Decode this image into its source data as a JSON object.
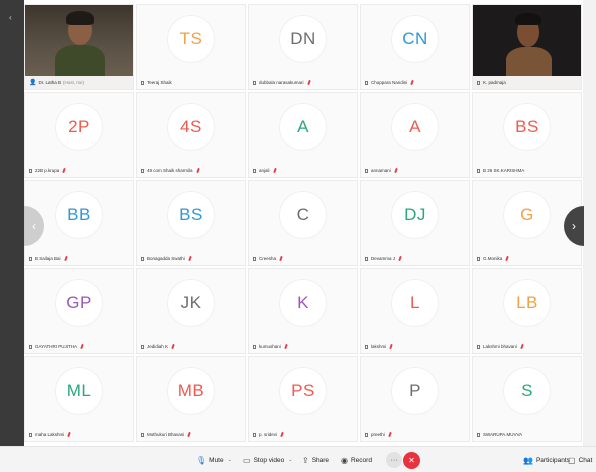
{
  "participants": [
    {
      "initials": "",
      "name": "Dr. Latha B",
      "tag": "(Host, me)",
      "video": true,
      "color": ""
    },
    {
      "initials": "TS",
      "name": "Teeraj Shaik",
      "video": false,
      "color": "#f0a245"
    },
    {
      "initials": "DN",
      "name": "dubbala narasakumari",
      "video": false,
      "color": "#6e6e6e"
    },
    {
      "initials": "CN",
      "name": "Choppara Nandini",
      "video": false,
      "color": "#2f97d6"
    },
    {
      "initials": "",
      "name": "K. padmaja",
      "video": true,
      "color": ""
    },
    {
      "initials": "2P",
      "name": "22B p.krupa",
      "video": false,
      "color": "#ef5a4d"
    },
    {
      "initials": "4S",
      "name": "49 com Shaik sharmila",
      "video": false,
      "color": "#ef5a4d"
    },
    {
      "initials": "A",
      "name": "anjali",
      "video": false,
      "color": "#2aa77a"
    },
    {
      "initials": "A",
      "name": "annamani",
      "video": false,
      "color": "#ef5a4d"
    },
    {
      "initials": "BS",
      "name": "B 26 SK.KARISHMA",
      "video": false,
      "color": "#ef5a4d"
    },
    {
      "initials": "BB",
      "name": "B Sailaja Bai",
      "video": false,
      "color": "#2f97d6"
    },
    {
      "initials": "BS",
      "name": "Bonagadda Swathi",
      "video": false,
      "color": "#2f97d6"
    },
    {
      "initials": "C",
      "name": "Creesha",
      "video": false,
      "color": "#6e6e6e"
    },
    {
      "initials": "DJ",
      "name": "Devamma J",
      "video": false,
      "color": "#2aa77a"
    },
    {
      "initials": "G",
      "name": "G.Monika",
      "video": false,
      "color": "#f0a245"
    },
    {
      "initials": "GP",
      "name": "GAYATHRI PUJITHA",
      "video": false,
      "color": "#9b59b6"
    },
    {
      "initials": "JK",
      "name": "Jedidiah K",
      "video": false,
      "color": "#6e6e6e"
    },
    {
      "initials": "K",
      "name": "kumushani",
      "video": false,
      "color": "#9b59b6"
    },
    {
      "initials": "L",
      "name": "lakshmi",
      "video": false,
      "color": "#ef5a4d"
    },
    {
      "initials": "LB",
      "name": "Lakshmi bhavani",
      "video": false,
      "color": "#f0a245"
    },
    {
      "initials": "ML",
      "name": "maha Lakshmi",
      "video": false,
      "color": "#2aa77a"
    },
    {
      "initials": "MB",
      "name": "Mothukuri Bhavani",
      "video": false,
      "color": "#ef5a4d"
    },
    {
      "initials": "PS",
      "name": "p. sridevi",
      "video": false,
      "color": "#ef5a4d"
    },
    {
      "initials": "P",
      "name": "preethi",
      "video": false,
      "color": "#6e6e6e"
    },
    {
      "initials": "S",
      "name": "SWARUPA.MUVVA",
      "video": false,
      "color": "#2aa77a"
    }
  ],
  "toolbar": {
    "mute": "Mute",
    "stop_video": "Stop video",
    "share": "Share",
    "record": "Record",
    "more": "···",
    "participants": "Participants",
    "chat": "Chat"
  },
  "colors": {
    "leave": "#e5333f",
    "muted_mic": "#e0424c",
    "host_icon": "#2b7bd6"
  },
  "icons": {
    "collapse": "chevron-left-icon",
    "prev_page": "chevron-left-icon",
    "next_page": "chevron-right-icon",
    "mute": "microphone-icon",
    "video": "video-camera-icon",
    "share": "share-icon",
    "record": "record-icon",
    "leave": "close-icon",
    "participants": "people-icon",
    "chat": "chat-bubble-icon"
  }
}
